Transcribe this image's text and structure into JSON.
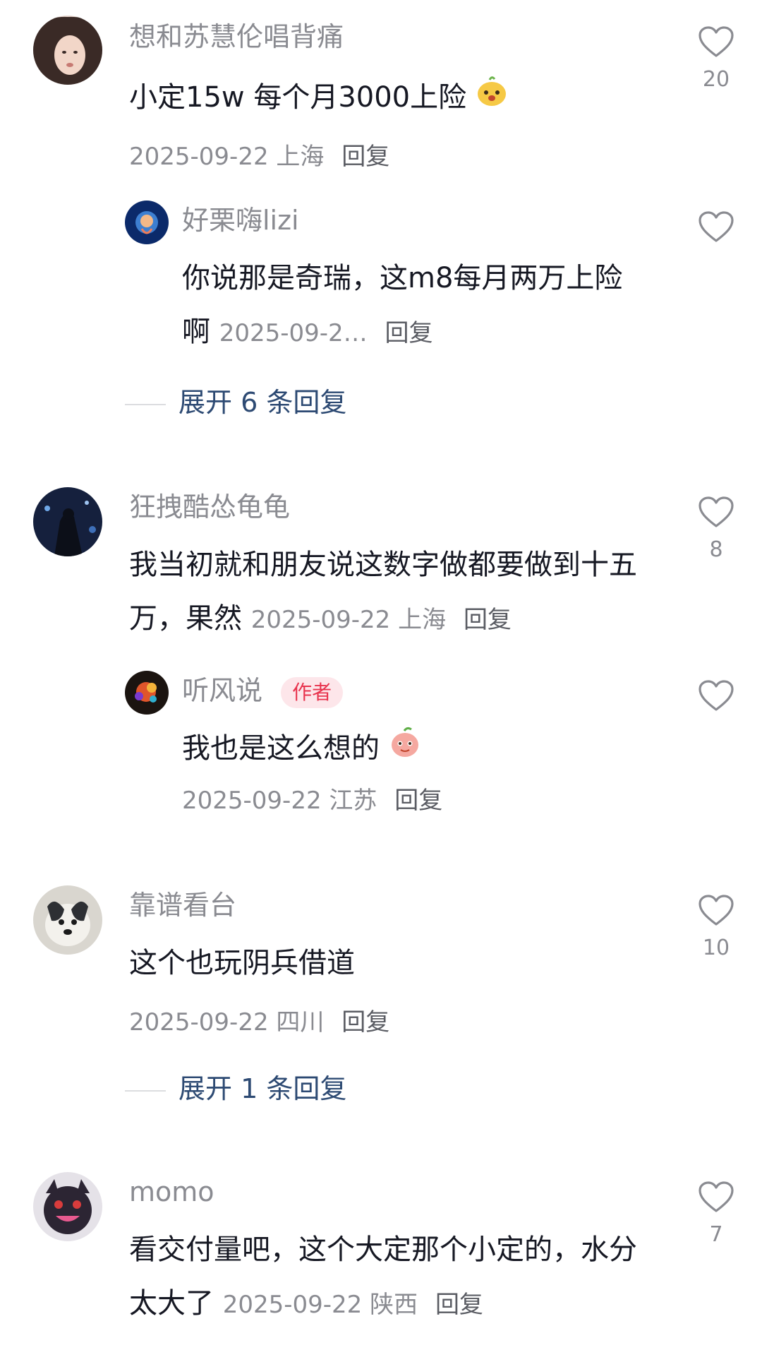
{
  "comments": [
    {
      "user": "想和苏慧伦唱背痛",
      "text": "小定15w 每个月3000上险",
      "date": "2025-09-22",
      "location": "上海",
      "reply_label": "回复",
      "likes": "20",
      "emoji": "yellow-face-emoji",
      "replies": [
        {
          "user": "好栗嗨lizi",
          "text": "你说那是奇瑞，这m8每月两万上险啊",
          "date": "2025-09-2…",
          "location": "",
          "reply_label": "回复"
        }
      ],
      "expand_label": "展开 6 条回复"
    },
    {
      "user": "狂拽酷怂龟龟",
      "text": "我当初就和朋友说这数字做都要做到十五万，果然",
      "date": "2025-09-22",
      "location": "上海",
      "reply_label": "回复",
      "likes": "8",
      "replies": [
        {
          "user": "听风说",
          "badge": "作者",
          "text": "我也是这么想的",
          "emoji": "peach-face-emoji",
          "date": "2025-09-22",
          "location": "江苏",
          "reply_label": "回复"
        }
      ]
    },
    {
      "user": "靠谱看台",
      "text": "这个也玩阴兵借道",
      "date": "2025-09-22",
      "location": "四川",
      "reply_label": "回复",
      "likes": "10",
      "expand_label": "展开 1 条回复"
    },
    {
      "user": "momo",
      "text": "看交付量吧，这个大定那个小定的，水分太大了",
      "date": "2025-09-22",
      "location": "陕西",
      "reply_label": "回复",
      "likes": "7"
    }
  ],
  "icons": {
    "like": "heart-outline-icon"
  },
  "colors": {
    "author_badge_bg": "#fde6ea",
    "author_badge_text": "#e8334d",
    "expand_text": "#2d4a73"
  }
}
